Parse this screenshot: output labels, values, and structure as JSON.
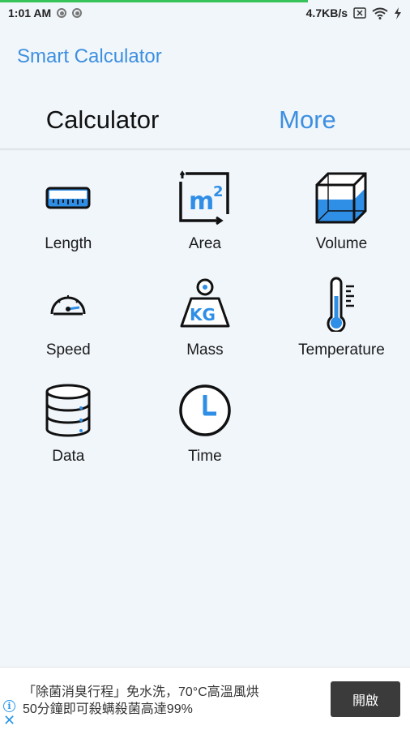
{
  "status_bar": {
    "time": "1:01 AM",
    "network_speed": "4.7KB/s"
  },
  "app": {
    "title": "Smart Calculator"
  },
  "tabs": [
    {
      "label": "Calculator",
      "active": true
    },
    {
      "label": "More",
      "active": false
    }
  ],
  "converters": [
    {
      "label": "Length",
      "icon": "ruler-icon"
    },
    {
      "label": "Area",
      "icon": "area-icon"
    },
    {
      "label": "Volume",
      "icon": "cube-icon"
    },
    {
      "label": "Speed",
      "icon": "speedometer-icon"
    },
    {
      "label": "Mass",
      "icon": "weight-icon"
    },
    {
      "label": "Temperature",
      "icon": "thermometer-icon"
    },
    {
      "label": "Data",
      "icon": "database-icon"
    },
    {
      "label": "Time",
      "icon": "clock-icon"
    }
  ],
  "ad": {
    "text_line1": "「除菌消臭行程」免水洗，70°C高溫風烘",
    "text_line2": "50分鐘即可殺螨殺菌高達99%",
    "button_label": "開啟",
    "info_symbol": "i",
    "close_symbol": "✕"
  },
  "colors": {
    "accent": "#3d8fe0",
    "background": "#f1f6fb",
    "icon_blue": "#2f8ee6"
  }
}
